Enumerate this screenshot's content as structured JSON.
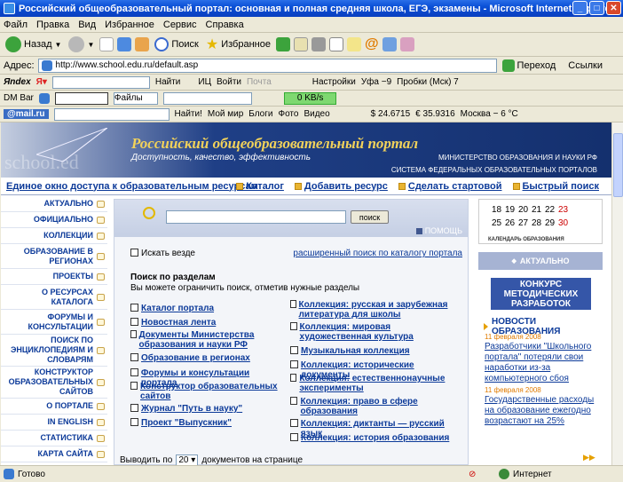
{
  "window": {
    "title": "Российский общеобразовательный портал: основная и полная средняя школа, ЕГЭ, экзамены - Microsoft Internet Explorer"
  },
  "menu": [
    "Файл",
    "Правка",
    "Вид",
    "Избранное",
    "Сервис",
    "Справка"
  ],
  "toolbar": {
    "back": "Назад",
    "search": "Поиск",
    "favorites": "Избранное"
  },
  "address": {
    "label": "Адрес:",
    "url": "http://www.school.edu.ru/default.asp",
    "go": "Переход",
    "links": "Ссылки"
  },
  "yandex": {
    "logo": "Яndex",
    "find": "Найти",
    "ic": "ИЦ",
    "login": "Войти",
    "mail": "Почта",
    "settings": "Настройки",
    "weather": "Уфа −9",
    "traffic": "Пробки (Мск) 7"
  },
  "dmbar": {
    "label": "DM Bar",
    "files": "Файлы",
    "speed": "0 KB/s"
  },
  "mailru": {
    "logo": "@mail.ru",
    "find": "Найти!",
    "myworld": "Мой мир",
    "blogs": "Блоги",
    "photo": "Фото",
    "video": "Видео",
    "usd": "$ 24.6715",
    "eur": "€ 35.9316",
    "weather": "Москва − 6 °C"
  },
  "banner": {
    "title": "Российский общеобразовательный портал",
    "subtitle": "Доступность, качество, эффективность",
    "ministry": "МИНИСТЕРСТВО ОБРАЗОВАНИЯ И НАУКИ РФ",
    "system": "СИСТЕМА ФЕДЕРАЛЬНЫХ ОБРАЗОВАТЕЛЬНЫХ ПОРТАЛОВ",
    "logo": "school.ed"
  },
  "nav": {
    "left": "Единое окно доступа к образовательным ресурсам",
    "catalog": "Каталог",
    "add": "Добавить ресурс",
    "home": "Сделать стартовой",
    "quick": "Быстрый поиск"
  },
  "sidebar": [
    {
      "label": "АКТУАЛЬНО"
    },
    {
      "label": "ОФИЦИАЛЬНО"
    },
    {
      "label": "КОЛЛЕКЦИИ"
    },
    {
      "label": "ОБРАЗОВАНИЕ В РЕГИОНАХ"
    },
    {
      "label": "ПРОЕКТЫ"
    },
    {
      "label": "О РЕСУРСАХ КАТАЛОГА"
    },
    {
      "label": "ФОРУМЫ И КОНСУЛЬТАЦИИ"
    },
    {
      "label": "ПОИСК ПО ЭНЦИКЛОПЕДИЯМ И СЛОВАРЯМ"
    },
    {
      "label": "КОНСТРУКТОР ОБРАЗОВАТЕЛЬНЫХ САЙТОВ"
    },
    {
      "label": "О ПОРТАЛЕ"
    },
    {
      "label": "IN ENGLISH"
    },
    {
      "label": "СТАТИСТИКА"
    },
    {
      "label": "КАРТА САЙТА"
    }
  ],
  "search": {
    "button": "поиск",
    "help": "ПОМОЩЬ",
    "everywhere": "Искать везде",
    "advanced": "расширенный поиск по каталогу портала",
    "sections_title": "Поиск по разделам",
    "sections_hint": "Вы можете ограничить поиск, отметив нужные разделы"
  },
  "sections_left": [
    "Каталог портала",
    "Новостная лента",
    "Документы Министерства образования и науки РФ",
    "Образование в регионах",
    "Форумы и консультации портала",
    "Конструктор образовательных сайтов",
    "Журнал \"Путь в науку\"",
    "Проект \"Выпускник\""
  ],
  "sections_right": [
    "Коллекция: русская и зарубежная литература для школы",
    "Коллекция: мировая художественная культура",
    "Музыкальная коллекция",
    "Коллекция: исторические документы",
    "Коллекция: естественнонаучные эксперименты",
    "Коллекция: право в сфере образования",
    "Коллекция: диктанты — русский язык",
    "Коллекция: история образования"
  ],
  "perpage": {
    "label": "Выводить по",
    "value": "20",
    "suffix": "документов на странице"
  },
  "calendar": {
    "row1": [
      "18",
      "19",
      "20",
      "21",
      "22",
      "23"
    ],
    "row2": [
      "25",
      "26",
      "27",
      "28",
      "29",
      "30"
    ],
    "caption": "КАЛЕНДАРЬ ОБРАЗОВАНИЯ"
  },
  "right": {
    "actual": "АКТУАЛЬНО",
    "contest": "КОНКУРС МЕТОДИЧЕСКИХ РАЗРАБОТОК",
    "news_title": "НОВОСТИ ОБРАЗОВАНИЯ",
    "news": [
      {
        "date": "11 февраля 2008",
        "text": "Разработчики \"Школьного портала\" потеряли свои наработки из-за компьютерного сбоя"
      },
      {
        "date": "11 февраля 2008",
        "text": "Государственные расходы на образование ежегодно возрастают на 25%"
      }
    ]
  },
  "status": {
    "left": "Готово",
    "zone": "Интернет"
  }
}
